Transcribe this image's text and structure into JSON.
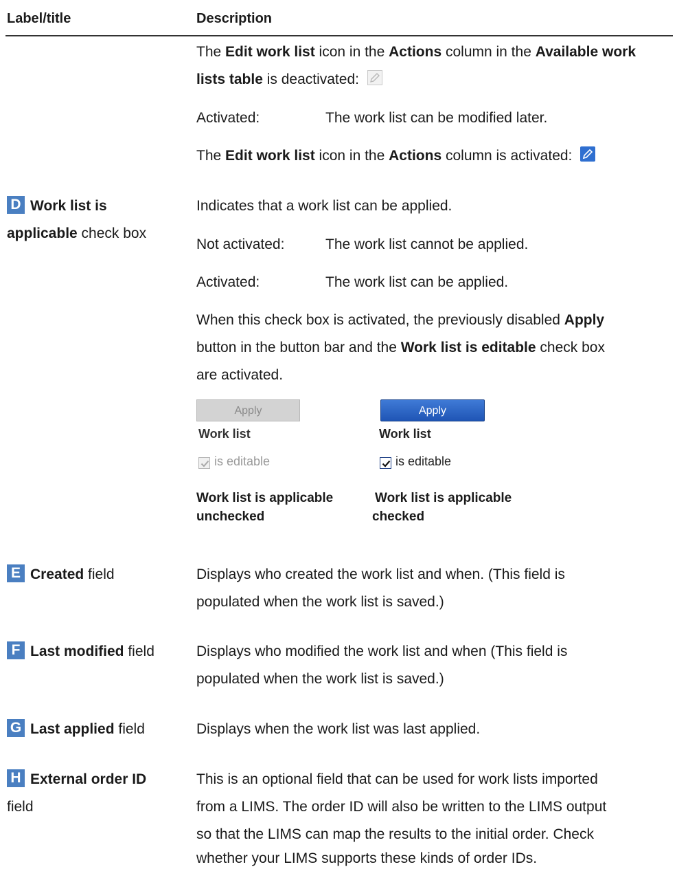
{
  "header": {
    "label_title": "Label/title",
    "description": "Description"
  },
  "intro": {
    "line1_a": "The ",
    "line1_b": "Edit work list",
    "line1_c": " icon in the ",
    "line1_d": "Actions",
    "line1_e": " column in the ",
    "line1_f": "Available work",
    "line2_a": "lists table",
    "line2_b": " is deactivated:",
    "activated_label": "Activated:",
    "activated_text": "The work list can be modified later.",
    "line3_a": "The ",
    "line3_b": "Edit work list",
    "line3_c": " icon in the ",
    "line3_d": "Actions",
    "line3_e": " column is activated:"
  },
  "rows": {
    "D": {
      "badge": "D",
      "label_bold": "Work list is",
      "label_bold2": "applicable",
      "label_rest": " check box",
      "desc": "Indicates that a work list can be applied.",
      "not_activated_label": "Not activated:",
      "not_activated_text": "The work list cannot be applied.",
      "activated_label": "Activated:",
      "activated_text": "The work list can be applied.",
      "para_l1_a": "When this check box is activated, the previously disabled ",
      "para_l1_b": "Apply",
      "para_l2_a": "button in the button bar and the ",
      "para_l2_b": "Work list is editable",
      "para_l2_c": " check box",
      "para_l3": "are activated.",
      "fig": {
        "apply": "Apply",
        "work_list": "Work list",
        "is_editable": "is editable",
        "cap_left_1": "Work list is applicable",
        "cap_left_2": "unchecked",
        "cap_right_1": "Work list is applicable",
        "cap_right_2": "checked"
      }
    },
    "E": {
      "badge": "E",
      "label_bold": "Created",
      "label_rest": " field",
      "desc1": "Displays who created the work list and when. (This field is",
      "desc2": "populated when the work list is saved.)"
    },
    "F": {
      "badge": "F",
      "label_bold": "Last modified",
      "label_rest": " field",
      "desc1": "Displays who modified the work list and when (This field is",
      "desc2": "populated when the work list is saved.)"
    },
    "G": {
      "badge": "G",
      "label_bold": "Last applied",
      "label_rest": " field",
      "desc1": "Displays when the work list was last applied."
    },
    "H": {
      "badge": "H",
      "label_bold": "External order ID",
      "label_rest": "field",
      "desc1": "This is an optional field that can be used for work lists imported",
      "desc2": "from a LIMS. The order ID will also be written to the LIMS output",
      "desc3": "so that the LIMS can map the results to the initial order. Check",
      "desc4": "whether your LIMS supports these kinds of order IDs."
    }
  },
  "colors": {
    "badge": "#4a7fc1",
    "apply_active": "#2a63c4"
  },
  "icons": {
    "edit_disabled": "pencil-disabled-icon",
    "edit_enabled": "pencil-icon"
  }
}
